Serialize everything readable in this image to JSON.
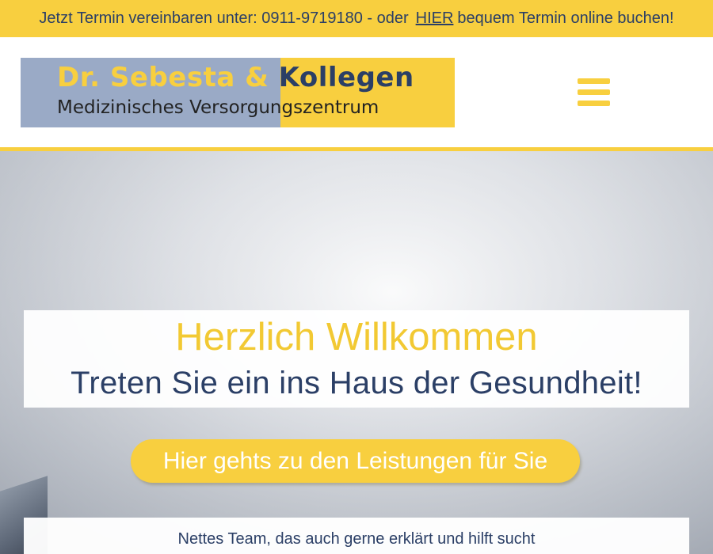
{
  "topbar": {
    "text_before": "Jetzt Termin vereinbaren unter: 0911-9719180 - oder",
    "link_label": "HIER",
    "text_after": "bequem Termin online buchen!",
    "background": "#f8cf3f",
    "text_color": "#2b3f66"
  },
  "logo": {
    "title_part1": "Dr. Sebesta &",
    "title_part2": "Kollegen",
    "subtitle": "Medizinisches Versorgungszentrum"
  },
  "menu": {
    "icon": "hamburger-menu-icon",
    "color": "#f8cf3f"
  },
  "hero": {
    "heading": "Herzlich Willkommen",
    "subheading": "Treten Sie ein ins Haus der Gesundheit!",
    "cta_label": "Hier gehts zu den Leistungen für Sie",
    "team_text": "Nettes Team, das auch gerne erklärt und hilft sucht"
  },
  "colors": {
    "accent": "#f8cf3f",
    "navy": "#2b3f66",
    "logo_blue": "#9aaac6"
  }
}
